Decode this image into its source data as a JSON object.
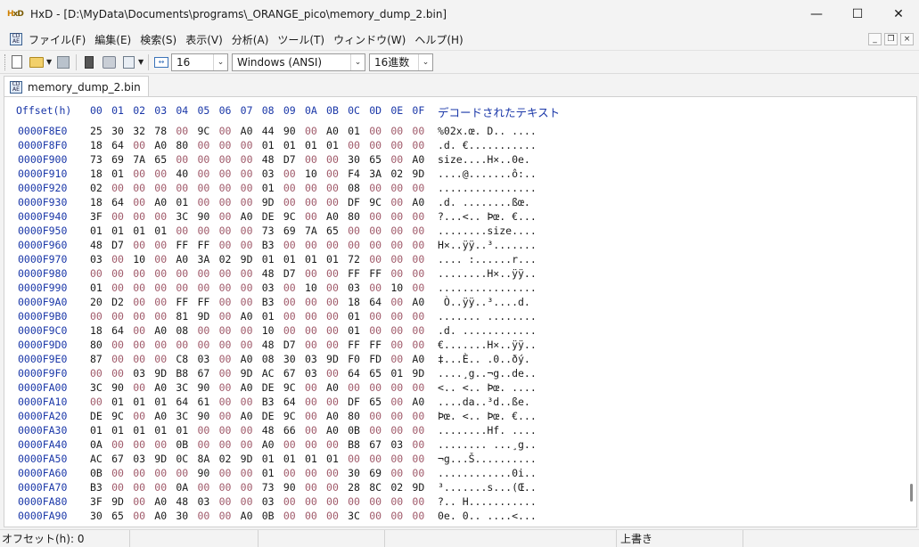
{
  "window": {
    "title": "HxD - [D:\\MyData\\Documents\\programs\\_ORANGE_pico\\memory_dump_2.bin]",
    "minimize": "—",
    "maximize": "☐",
    "close": "✕"
  },
  "menu": {
    "items": [
      "ファイル(F)",
      "編集(E)",
      "検索(S)",
      "表示(V)",
      "分析(A)",
      "ツール(T)",
      "ウィンドウ(W)",
      "ヘルプ(H)"
    ]
  },
  "toolbar": {
    "bytes_per_row": "16",
    "charset": "Windows (ANSI)",
    "offset_base": "16進数"
  },
  "tab": {
    "label": "memory_dump_2.bin"
  },
  "editor": {
    "offset_header": "Offset(h)",
    "column_headers": [
      "00",
      "01",
      "02",
      "03",
      "04",
      "05",
      "06",
      "07",
      "08",
      "09",
      "0A",
      "0B",
      "0C",
      "0D",
      "0E",
      "0F"
    ],
    "decoded_header": "デコードされたテキスト",
    "rows": [
      {
        "offset": "0000F8E0",
        "bytes": [
          "25",
          "30",
          "32",
          "78",
          "00",
          "9C",
          "00",
          "A0",
          "44",
          "90",
          "00",
          "A0",
          "01",
          "00",
          "00",
          "00"
        ],
        "ascii": "%02x.œ. D.. ...."
      },
      {
        "offset": "0000F8F0",
        "bytes": [
          "18",
          "64",
          "00",
          "A0",
          "80",
          "00",
          "00",
          "00",
          "01",
          "01",
          "01",
          "01",
          "00",
          "00",
          "00",
          "00"
        ],
        "ascii": ".d. €..........."
      },
      {
        "offset": "0000F900",
        "bytes": [
          "73",
          "69",
          "7A",
          "65",
          "00",
          "00",
          "00",
          "00",
          "48",
          "D7",
          "00",
          "00",
          "30",
          "65",
          "00",
          "A0"
        ],
        "ascii": "size....H×..0e. "
      },
      {
        "offset": "0000F910",
        "bytes": [
          "18",
          "01",
          "00",
          "00",
          "40",
          "00",
          "00",
          "00",
          "03",
          "00",
          "10",
          "00",
          "F4",
          "3A",
          "02",
          "9D"
        ],
        "ascii": "....@.......ô:.."
      },
      {
        "offset": "0000F920",
        "bytes": [
          "02",
          "00",
          "00",
          "00",
          "00",
          "00",
          "00",
          "00",
          "01",
          "00",
          "00",
          "00",
          "08",
          "00",
          "00",
          "00"
        ],
        "ascii": "................"
      },
      {
        "offset": "0000F930",
        "bytes": [
          "18",
          "64",
          "00",
          "A0",
          "01",
          "00",
          "00",
          "00",
          "9D",
          "00",
          "00",
          "00",
          "DF",
          "9C",
          "00",
          "A0"
        ],
        "ascii": ".d. ........ßœ. "
      },
      {
        "offset": "0000F940",
        "bytes": [
          "3F",
          "00",
          "00",
          "00",
          "3C",
          "90",
          "00",
          "A0",
          "DE",
          "9C",
          "00",
          "A0",
          "80",
          "00",
          "00",
          "00"
        ],
        "ascii": "?...<.. Þœ. €..."
      },
      {
        "offset": "0000F950",
        "bytes": [
          "01",
          "01",
          "01",
          "01",
          "00",
          "00",
          "00",
          "00",
          "73",
          "69",
          "7A",
          "65",
          "00",
          "00",
          "00",
          "00"
        ],
        "ascii": "........size...."
      },
      {
        "offset": "0000F960",
        "bytes": [
          "48",
          "D7",
          "00",
          "00",
          "FF",
          "FF",
          "00",
          "00",
          "B3",
          "00",
          "00",
          "00",
          "00",
          "00",
          "00",
          "00"
        ],
        "ascii": "H×..ÿÿ..³......."
      },
      {
        "offset": "0000F970",
        "bytes": [
          "03",
          "00",
          "10",
          "00",
          "A0",
          "3A",
          "02",
          "9D",
          "01",
          "01",
          "01",
          "01",
          "72",
          "00",
          "00",
          "00"
        ],
        "ascii": ".... :......r..."
      },
      {
        "offset": "0000F980",
        "bytes": [
          "00",
          "00",
          "00",
          "00",
          "00",
          "00",
          "00",
          "00",
          "48",
          "D7",
          "00",
          "00",
          "FF",
          "FF",
          "00",
          "00"
        ],
        "ascii": "........H×..ÿÿ.."
      },
      {
        "offset": "0000F990",
        "bytes": [
          "01",
          "00",
          "00",
          "00",
          "00",
          "00",
          "00",
          "00",
          "03",
          "00",
          "10",
          "00",
          "03",
          "00",
          "10",
          "00"
        ],
        "ascii": "................"
      },
      {
        "offset": "0000F9A0",
        "bytes": [
          "20",
          "D2",
          "00",
          "00",
          "FF",
          "FF",
          "00",
          "00",
          "B3",
          "00",
          "00",
          "00",
          "18",
          "64",
          "00",
          "A0"
        ],
        "ascii": " Ò..ÿÿ..³....d. "
      },
      {
        "offset": "0000F9B0",
        "bytes": [
          "00",
          "00",
          "00",
          "00",
          "81",
          "9D",
          "00",
          "A0",
          "01",
          "00",
          "00",
          "00",
          "01",
          "00",
          "00",
          "00"
        ],
        "ascii": "....... ........"
      },
      {
        "offset": "0000F9C0",
        "bytes": [
          "18",
          "64",
          "00",
          "A0",
          "08",
          "00",
          "00",
          "00",
          "10",
          "00",
          "00",
          "00",
          "01",
          "00",
          "00",
          "00"
        ],
        "ascii": ".d. ............"
      },
      {
        "offset": "0000F9D0",
        "bytes": [
          "80",
          "00",
          "00",
          "00",
          "00",
          "00",
          "00",
          "00",
          "48",
          "D7",
          "00",
          "00",
          "FF",
          "FF",
          "00",
          "00"
        ],
        "ascii": "€.......H×..ÿÿ.."
      },
      {
        "offset": "0000F9E0",
        "bytes": [
          "87",
          "00",
          "00",
          "00",
          "C8",
          "03",
          "00",
          "A0",
          "08",
          "30",
          "03",
          "9D",
          "F0",
          "FD",
          "00",
          "A0"
        ],
        "ascii": "‡...È.. .0..ðý. "
      },
      {
        "offset": "0000F9F0",
        "bytes": [
          "00",
          "00",
          "03",
          "9D",
          "B8",
          "67",
          "00",
          "9D",
          "AC",
          "67",
          "03",
          "00",
          "64",
          "65",
          "01",
          "9D"
        ],
        "ascii": "....¸g..¬g..de.."
      },
      {
        "offset": "0000FA00",
        "bytes": [
          "3C",
          "90",
          "00",
          "A0",
          "3C",
          "90",
          "00",
          "A0",
          "DE",
          "9C",
          "00",
          "A0",
          "00",
          "00",
          "00",
          "00"
        ],
        "ascii": "<.. <.. Þœ. ...."
      },
      {
        "offset": "0000FA10",
        "bytes": [
          "00",
          "01",
          "01",
          "01",
          "64",
          "61",
          "00",
          "00",
          "B3",
          "64",
          "00",
          "00",
          "DF",
          "65",
          "00",
          "A0"
        ],
        "ascii": "....da..³d..ße. "
      },
      {
        "offset": "0000FA20",
        "bytes": [
          "DE",
          "9C",
          "00",
          "A0",
          "3C",
          "90",
          "00",
          "A0",
          "DE",
          "9C",
          "00",
          "A0",
          "80",
          "00",
          "00",
          "00"
        ],
        "ascii": "Þœ. <.. Þœ. €..."
      },
      {
        "offset": "0000FA30",
        "bytes": [
          "01",
          "01",
          "01",
          "01",
          "01",
          "00",
          "00",
          "00",
          "48",
          "66",
          "00",
          "A0",
          "0B",
          "00",
          "00",
          "00"
        ],
        "ascii": "........Hf. ...."
      },
      {
        "offset": "0000FA40",
        "bytes": [
          "0A",
          "00",
          "00",
          "00",
          "0B",
          "00",
          "00",
          "00",
          "A0",
          "00",
          "00",
          "00",
          "B8",
          "67",
          "03",
          "00"
        ],
        "ascii": "........ ...¸g.."
      },
      {
        "offset": "0000FA50",
        "bytes": [
          "AC",
          "67",
          "03",
          "9D",
          "0C",
          "8A",
          "02",
          "9D",
          "01",
          "01",
          "01",
          "01",
          "00",
          "00",
          "00",
          "00"
        ],
        "ascii": "¬g...Š.........."
      },
      {
        "offset": "0000FA60",
        "bytes": [
          "0B",
          "00",
          "00",
          "00",
          "00",
          "90",
          "00",
          "00",
          "01",
          "00",
          "00",
          "00",
          "30",
          "69",
          "00",
          "00"
        ],
        "ascii": "............0i.."
      },
      {
        "offset": "0000FA70",
        "bytes": [
          "B3",
          "00",
          "00",
          "00",
          "0A",
          "00",
          "00",
          "00",
          "73",
          "90",
          "00",
          "00",
          "28",
          "8C",
          "02",
          "9D"
        ],
        "ascii": "³.......s...(Œ.."
      },
      {
        "offset": "0000FA80",
        "bytes": [
          "3F",
          "9D",
          "00",
          "A0",
          "48",
          "03",
          "00",
          "00",
          "03",
          "00",
          "00",
          "00",
          "00",
          "00",
          "00",
          "00"
        ],
        "ascii": "?.. H..........."
      },
      {
        "offset": "0000FA90",
        "bytes": [
          "30",
          "65",
          "00",
          "A0",
          "30",
          "00",
          "00",
          "A0",
          "0B",
          "00",
          "00",
          "00",
          "3C",
          "00",
          "00",
          "00"
        ],
        "ascii": "0e. 0.. ....<..."
      }
    ]
  },
  "status": {
    "offset": "オフセット(h): 0",
    "mode": "上書き"
  }
}
